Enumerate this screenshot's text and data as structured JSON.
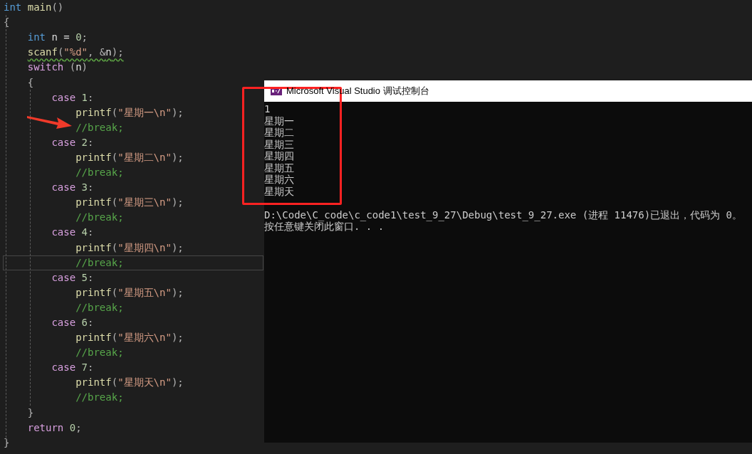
{
  "editor": {
    "lines": [
      {
        "current": false,
        "squiggle": false,
        "tokens": [
          {
            "kind": "keyword",
            "text": "int "
          },
          {
            "kind": "func",
            "text": "main"
          },
          {
            "kind": "plain",
            "text": "()"
          }
        ]
      },
      {
        "current": false,
        "squiggle": false,
        "tokens": [
          {
            "kind": "plain",
            "text": "{"
          }
        ]
      },
      {
        "current": false,
        "squiggle": false,
        "tokens": [
          {
            "kind": "keyword",
            "text": "    int "
          },
          {
            "kind": "var",
            "text": "n = "
          },
          {
            "kind": "number",
            "text": "0"
          },
          {
            "kind": "plain",
            "text": ";"
          }
        ]
      },
      {
        "current": false,
        "squiggle": true,
        "tokens": [
          {
            "kind": "func",
            "text": "    scanf"
          },
          {
            "kind": "plain",
            "text": "("
          },
          {
            "kind": "string",
            "text": "\"%d\""
          },
          {
            "kind": "plain",
            "text": ", &"
          },
          {
            "kind": "var",
            "text": "n"
          },
          {
            "kind": "plain",
            "text": ");"
          }
        ]
      },
      {
        "current": false,
        "squiggle": false,
        "tokens": [
          {
            "kind": "control",
            "text": "    switch "
          },
          {
            "kind": "plain",
            "text": "("
          },
          {
            "kind": "var",
            "text": "n"
          },
          {
            "kind": "plain",
            "text": ")"
          }
        ]
      },
      {
        "current": false,
        "squiggle": false,
        "tokens": [
          {
            "kind": "plain",
            "text": "    {"
          }
        ]
      },
      {
        "current": false,
        "squiggle": false,
        "tokens": [
          {
            "kind": "control",
            "text": "        case "
          },
          {
            "kind": "number",
            "text": "1"
          },
          {
            "kind": "plain",
            "text": ":"
          }
        ]
      },
      {
        "current": false,
        "squiggle": false,
        "tokens": [
          {
            "kind": "func",
            "text": "            printf"
          },
          {
            "kind": "plain",
            "text": "("
          },
          {
            "kind": "string",
            "text": "\"星期一\\n\""
          },
          {
            "kind": "plain",
            "text": ");"
          }
        ]
      },
      {
        "current": false,
        "squiggle": false,
        "tokens": [
          {
            "kind": "comment",
            "text": "            //break;"
          }
        ]
      },
      {
        "current": false,
        "squiggle": false,
        "tokens": [
          {
            "kind": "control",
            "text": "        case "
          },
          {
            "kind": "number",
            "text": "2"
          },
          {
            "kind": "plain",
            "text": ":"
          }
        ]
      },
      {
        "current": false,
        "squiggle": false,
        "tokens": [
          {
            "kind": "func",
            "text": "            printf"
          },
          {
            "kind": "plain",
            "text": "("
          },
          {
            "kind": "string",
            "text": "\"星期二\\n\""
          },
          {
            "kind": "plain",
            "text": ");"
          }
        ]
      },
      {
        "current": false,
        "squiggle": false,
        "tokens": [
          {
            "kind": "comment",
            "text": "            //break;"
          }
        ]
      },
      {
        "current": false,
        "squiggle": false,
        "tokens": [
          {
            "kind": "control",
            "text": "        case "
          },
          {
            "kind": "number",
            "text": "3"
          },
          {
            "kind": "plain",
            "text": ":"
          }
        ]
      },
      {
        "current": false,
        "squiggle": false,
        "tokens": [
          {
            "kind": "func",
            "text": "            printf"
          },
          {
            "kind": "plain",
            "text": "("
          },
          {
            "kind": "string",
            "text": "\"星期三\\n\""
          },
          {
            "kind": "plain",
            "text": ");"
          }
        ]
      },
      {
        "current": false,
        "squiggle": false,
        "tokens": [
          {
            "kind": "comment",
            "text": "            //break;"
          }
        ]
      },
      {
        "current": false,
        "squiggle": false,
        "tokens": [
          {
            "kind": "control",
            "text": "        case "
          },
          {
            "kind": "number",
            "text": "4"
          },
          {
            "kind": "plain",
            "text": ":"
          }
        ]
      },
      {
        "current": false,
        "squiggle": false,
        "tokens": [
          {
            "kind": "func",
            "text": "            printf"
          },
          {
            "kind": "plain",
            "text": "("
          },
          {
            "kind": "string",
            "text": "\"星期四\\n\""
          },
          {
            "kind": "plain",
            "text": ");"
          }
        ]
      },
      {
        "current": true,
        "squiggle": false,
        "tokens": [
          {
            "kind": "comment",
            "text": "            //break;"
          }
        ]
      },
      {
        "current": false,
        "squiggle": false,
        "tokens": [
          {
            "kind": "control",
            "text": "        case "
          },
          {
            "kind": "number",
            "text": "5"
          },
          {
            "kind": "plain",
            "text": ":"
          }
        ]
      },
      {
        "current": false,
        "squiggle": false,
        "tokens": [
          {
            "kind": "func",
            "text": "            printf"
          },
          {
            "kind": "plain",
            "text": "("
          },
          {
            "kind": "string",
            "text": "\"星期五\\n\""
          },
          {
            "kind": "plain",
            "text": ");"
          }
        ]
      },
      {
        "current": false,
        "squiggle": false,
        "tokens": [
          {
            "kind": "comment",
            "text": "            //break;"
          }
        ]
      },
      {
        "current": false,
        "squiggle": false,
        "tokens": [
          {
            "kind": "control",
            "text": "        case "
          },
          {
            "kind": "number",
            "text": "6"
          },
          {
            "kind": "plain",
            "text": ":"
          }
        ]
      },
      {
        "current": false,
        "squiggle": false,
        "tokens": [
          {
            "kind": "func",
            "text": "            printf"
          },
          {
            "kind": "plain",
            "text": "("
          },
          {
            "kind": "string",
            "text": "\"星期六\\n\""
          },
          {
            "kind": "plain",
            "text": ");"
          }
        ]
      },
      {
        "current": false,
        "squiggle": false,
        "tokens": [
          {
            "kind": "comment",
            "text": "            //break;"
          }
        ]
      },
      {
        "current": false,
        "squiggle": false,
        "tokens": [
          {
            "kind": "control",
            "text": "        case "
          },
          {
            "kind": "number",
            "text": "7"
          },
          {
            "kind": "plain",
            "text": ":"
          }
        ]
      },
      {
        "current": false,
        "squiggle": false,
        "tokens": [
          {
            "kind": "func",
            "text": "            printf"
          },
          {
            "kind": "plain",
            "text": "("
          },
          {
            "kind": "string",
            "text": "\"星期天\\n\""
          },
          {
            "kind": "plain",
            "text": ");"
          }
        ]
      },
      {
        "current": false,
        "squiggle": false,
        "tokens": [
          {
            "kind": "comment",
            "text": "            //break;"
          }
        ]
      },
      {
        "current": false,
        "squiggle": false,
        "tokens": [
          {
            "kind": "plain",
            "text": "    }"
          }
        ]
      },
      {
        "current": false,
        "squiggle": false,
        "tokens": [
          {
            "kind": "control",
            "text": "    return "
          },
          {
            "kind": "number",
            "text": "0"
          },
          {
            "kind": "plain",
            "text": ";"
          }
        ]
      },
      {
        "current": false,
        "squiggle": false,
        "tokens": [
          {
            "kind": "plain",
            "text": "}"
          }
        ]
      }
    ]
  },
  "console": {
    "title": "Microsoft Visual Studio 调试控制台",
    "output_lines": [
      "1",
      "星期一",
      "星期二",
      "星期三",
      "星期四",
      "星期五",
      "星期六",
      "星期天"
    ],
    "exit_lines": [
      "D:\\Code\\C_code\\c_code1\\test_9_27\\Debug\\test_9_27.exe (进程 11476)已退出，代码为 0。",
      "按任意键关闭此窗口. . ."
    ]
  }
}
